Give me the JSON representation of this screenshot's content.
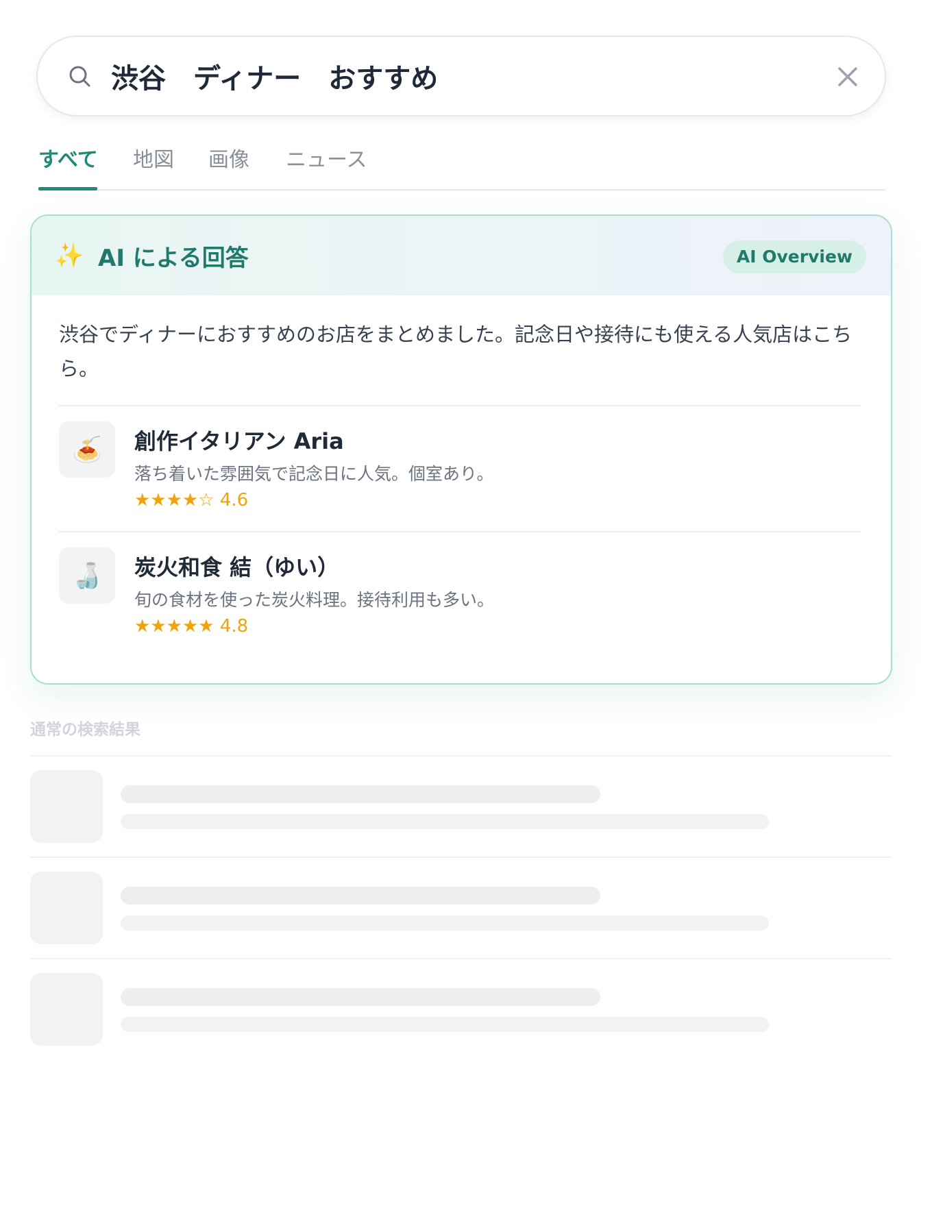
{
  "search": {
    "query": "渋谷　ディナー　おすすめ"
  },
  "tabs": [
    {
      "label": "すべて",
      "active": true
    },
    {
      "label": "地図",
      "active": false
    },
    {
      "label": "画像",
      "active": false
    },
    {
      "label": "ニュース",
      "active": false
    }
  ],
  "ai_overview": {
    "icon": "sparkle-icon",
    "title": "AI による回答",
    "badge": "AI Overview",
    "summary": "渋谷でディナーにおすすめのお店をまとめました。記念日や接待にも使える人気店はこちら。",
    "restaurants": [
      {
        "icon": "🍝",
        "name": "創作イタリアン Aria",
        "description": "落ち着いた雰囲気で記念日に人気。個室あり。",
        "stars": "★★★★☆",
        "rating": "4.6"
      },
      {
        "icon": "🍶",
        "name": "炭火和食 結（ゆい）",
        "description": "旬の食材を使った炭火料理。接待利用も多い。",
        "stars": "★★★★★",
        "rating": "4.8"
      }
    ]
  },
  "results": {
    "label": "通常の検索結果"
  },
  "colors": {
    "accent": "#1f8a78",
    "star": "#f0a30a",
    "card_border": "#a8ddd0"
  }
}
